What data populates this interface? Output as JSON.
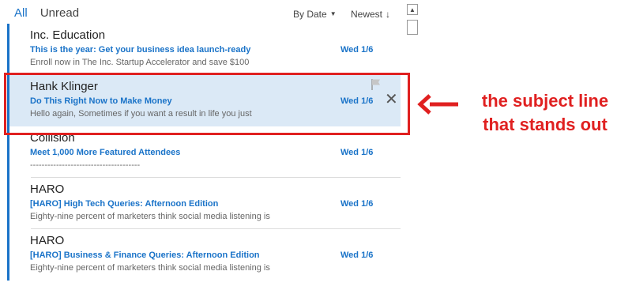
{
  "tabs": [
    {
      "label": "All"
    },
    {
      "label": "Unread"
    }
  ],
  "sort": {
    "by_label": "By Date",
    "order_label": "Newest",
    "order_icon": "arrow-down-icon"
  },
  "messages": [
    {
      "sender": "Inc. Education",
      "subject": "This is the year: Get your business idea launch-ready",
      "date": "Wed 1/6",
      "preview": "Enroll now in The Inc. Startup Accelerator and save $100"
    },
    {
      "sender": "Hank Klinger",
      "subject": "Do This Right Now to Make Money",
      "date": "Wed 1/6",
      "preview": "Hello again,  Sometimes if you want a result in life  you just",
      "selected": true
    },
    {
      "sender": "Collision",
      "subject": "Meet 1,000 More Featured Attendees",
      "date": "Wed 1/6",
      "preview": "--------------------------------------"
    },
    {
      "sender": "HARO",
      "subject": "[HARO] High Tech Queries: Afternoon Edition",
      "date": "Wed 1/6",
      "preview": "Eighty-nine percent of marketers think social media listening is"
    },
    {
      "sender": "HARO",
      "subject": "[HARO] Business & Finance Queries: Afternoon Edition",
      "date": "Wed 1/6",
      "preview": "Eighty-nine percent of marketers think social media listening is"
    }
  ],
  "annotation": {
    "line1": "the subject line",
    "line2": "that stands out"
  },
  "colors": {
    "accent": "#1a73c8",
    "selected_bg": "#dbe9f6",
    "annotation": "#e02020"
  }
}
